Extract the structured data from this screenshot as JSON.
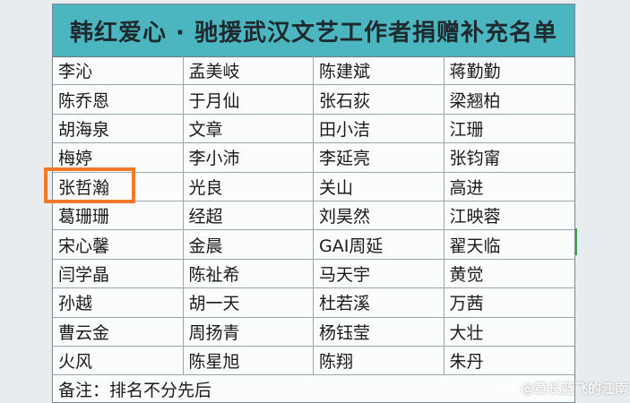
{
  "title": "韩红爱心 · 驰援武汉文艺工作者捐赠补充名单",
  "rows": [
    [
      "李沁",
      "孟美岐",
      "陈建斌",
      "蒋勤勤"
    ],
    [
      "陈乔恩",
      "于月仙",
      "张石荻",
      "梁翘柏"
    ],
    [
      "胡海泉",
      "文章",
      "田小洁",
      "江珊"
    ],
    [
      "梅婷",
      "李小沛",
      "李延亮",
      "张钧甯"
    ],
    [
      "张哲瀚",
      "光良",
      "关山",
      "高进"
    ],
    [
      "葛珊珊",
      "经超",
      "刘昊然",
      "江映蓉"
    ],
    [
      "宋心馨",
      "金晨",
      "GAI周延",
      "翟天临"
    ],
    [
      "闫学晶",
      "陈祉希",
      "马天宇",
      "黄觉"
    ],
    [
      "孙越",
      "胡一天",
      "杜若溪",
      "万茜"
    ],
    [
      "曹云金",
      "周扬青",
      "杨钰莹",
      "大壮"
    ],
    [
      "火风",
      "陈星旭",
      "陈翔",
      "朱丹"
    ]
  ],
  "note": "备注：排名不分先后",
  "watermark": "@章长蓝飞的江南",
  "colors": {
    "title_bg": "#4bb5c0",
    "highlight": "#f07a2a"
  }
}
